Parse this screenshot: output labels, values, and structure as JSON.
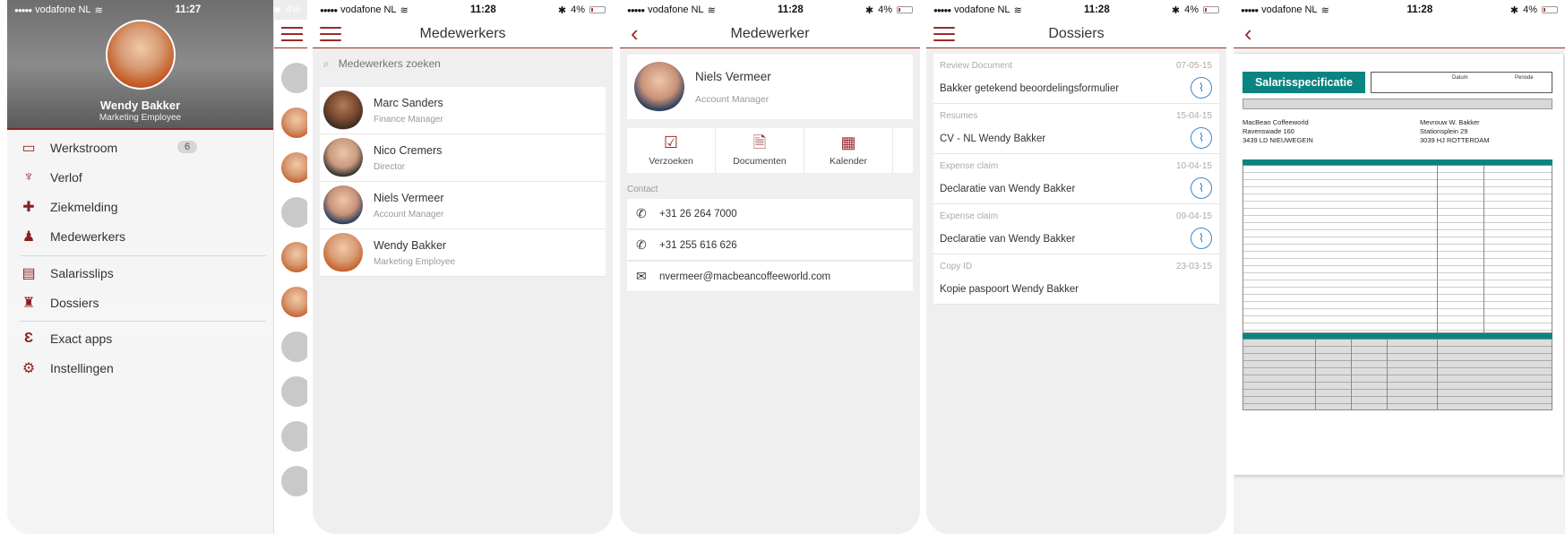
{
  "status": {
    "p1": {
      "carrier": "vodafone NL",
      "time": "11:27",
      "battery": "4%"
    },
    "p2": {
      "carrier": "vodafone NL",
      "time": "11:28",
      "battery": "4%"
    },
    "p3": {
      "carrier": "vodafone NL",
      "time": "11:28",
      "battery": "4%"
    },
    "p4": {
      "carrier": "vodafone NL",
      "time": "11:28",
      "battery": "4%"
    },
    "p5": {
      "carrier": "vodafone NL",
      "time": "11:28",
      "battery": "4%"
    }
  },
  "menu": {
    "user": {
      "name": "Wendy Bakker",
      "role": "Marketing Employee"
    },
    "items": [
      {
        "label": "Werkstroom",
        "icon": "inbox-icon",
        "badge": "6"
      },
      {
        "label": "Verlof",
        "icon": "palm-tree-icon"
      },
      {
        "label": "Ziekmelding",
        "icon": "medical-bag-icon"
      },
      {
        "label": "Medewerkers",
        "icon": "person-icon"
      },
      {
        "label": "Salarisslips",
        "icon": "payslip-icon"
      },
      {
        "label": "Dossiers",
        "icon": "person-file-icon"
      },
      {
        "label": "Exact apps",
        "icon": "exact-logo-icon"
      },
      {
        "label": "Instellingen",
        "icon": "gear-icon"
      }
    ]
  },
  "employees": {
    "title": "Medewerkers",
    "search_placeholder": "Medewerkers zoeken",
    "list": [
      {
        "name": "Marc Sanders",
        "role": "Finance Manager"
      },
      {
        "name": "Nico Cremers",
        "role": "Director"
      },
      {
        "name": "Niels Vermeer",
        "role": "Account Manager"
      },
      {
        "name": "Wendy Bakker",
        "role": "Marketing Employee"
      }
    ]
  },
  "employee": {
    "title": "Medewerker",
    "name": "Niels Vermeer",
    "role": "Account Manager",
    "actions": [
      {
        "label": "Verzoeken",
        "icon": "clipboard-check-icon"
      },
      {
        "label": "Documenten",
        "icon": "document-icon"
      },
      {
        "label": "Kalender",
        "icon": "calendar-icon"
      }
    ],
    "contact_label": "Contact",
    "contacts": [
      {
        "value": "+31 26 264 7000",
        "icon": "phone-icon"
      },
      {
        "value": "+31 255 616 626",
        "icon": "phone-icon"
      },
      {
        "value": "nvermeer@macbeancoffeeworld.com",
        "icon": "mail-icon"
      }
    ]
  },
  "dossiers": {
    "title": "Dossiers",
    "items": [
      {
        "type": "Review Document",
        "date": "07-05-15",
        "title": "Bakker getekend beoordelingsformulier",
        "attachment": true
      },
      {
        "type": "Resumes",
        "date": "15-04-15",
        "title": "CV - NL Wendy Bakker",
        "attachment": true
      },
      {
        "type": "Expense claim",
        "date": "10-04-15",
        "title": "Declaratie van Wendy Bakker",
        "attachment": true
      },
      {
        "type": "Expense claim",
        "date": "09-04-15",
        "title": "Declaratie van Wendy Bakker",
        "attachment": true
      },
      {
        "type": "Copy ID",
        "date": "23-03-15",
        "title": "Kopie paspoort Wendy Bakker",
        "attachment": false
      }
    ]
  },
  "payslip": {
    "title": "Salarisspecificatie",
    "meta": {
      "datum_label": "Datum",
      "periode_label": "Periode"
    },
    "employer": {
      "name": "MacBean Coffeeworld",
      "street": "Ravenswade 160",
      "city": "3439 LD NIEUWEGEIN"
    },
    "employee": {
      "name": "Mevrouw W. Bakker",
      "street": "Stationsplein 29",
      "city": "3039 HJ ROTTERDAM"
    }
  },
  "colors": {
    "brand": "#9b2a2a",
    "teal": "#0a8480",
    "link": "#3d85c6"
  }
}
